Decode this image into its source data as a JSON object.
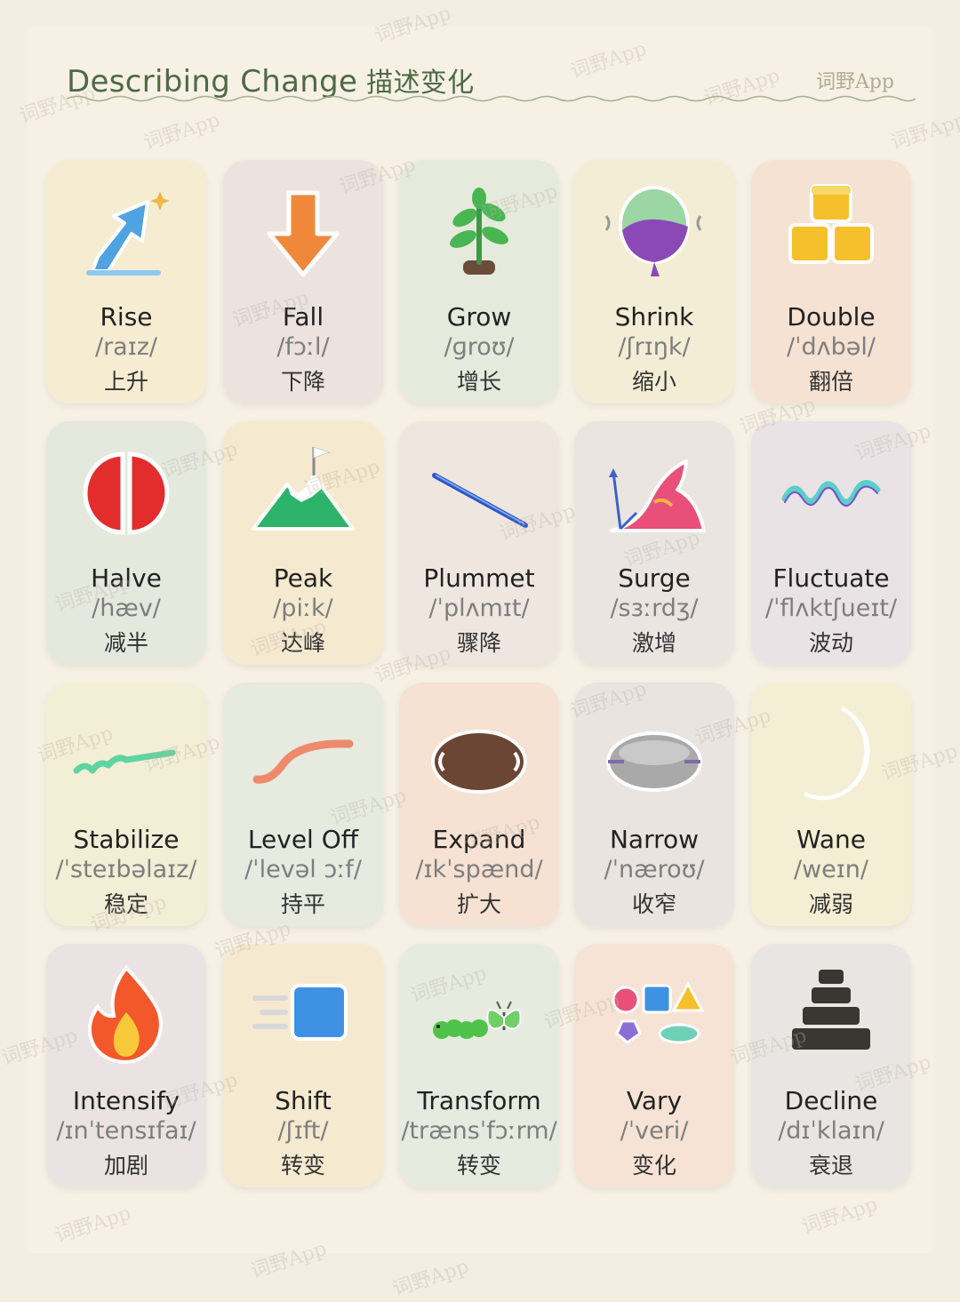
{
  "header": {
    "title": "Describing Change",
    "title_zh": "描述变化",
    "brand": "词野App"
  },
  "watermark": "词野App",
  "colors": {
    "title": "#4d6a45",
    "background": "#f3ede2",
    "card_yellow": "#f5ecd2",
    "card_pink": "#ede3e0",
    "card_green": "#e7ecdf",
    "card_peach": "#f5e3d5",
    "card_lilac": "#ebe3e6"
  },
  "cards": [
    {
      "word": "Rise",
      "ipa": "/raɪz/",
      "zh": "上升",
      "icon": "blue-arrow-up-icon",
      "bg": "#f5ecd2"
    },
    {
      "word": "Fall",
      "ipa": "/fɔːl/",
      "zh": "下降",
      "icon": "orange-arrow-down-icon",
      "bg": "#ece2de"
    },
    {
      "word": "Grow",
      "ipa": "/ɡroʊ/",
      "zh": "增长",
      "icon": "sprout-icon",
      "bg": "#e6eadc"
    },
    {
      "word": "Shrink",
      "ipa": "/ʃrɪŋk/",
      "zh": "缩小",
      "icon": "deflating-balloon-icon",
      "bg": "#f4edd5"
    },
    {
      "word": "Double",
      "ipa": "/ˈdʌbəl/",
      "zh": "翻倍",
      "icon": "stacked-cubes-icon",
      "bg": "#f6e2d3"
    },
    {
      "word": "Halve",
      "ipa": "/hæv/",
      "zh": "减半",
      "icon": "split-circle-icon",
      "bg": "#e5e8dd"
    },
    {
      "word": "Peak",
      "ipa": "/piːk/",
      "zh": "达峰",
      "icon": "mountain-flag-icon",
      "bg": "#f5ead0"
    },
    {
      "word": "Plummet",
      "ipa": "/ˈplʌmɪt/",
      "zh": "骤降",
      "icon": "falling-line-icon",
      "bg": "#efe7df"
    },
    {
      "word": "Surge",
      "ipa": "/sɜːrdʒ/",
      "zh": "激增",
      "icon": "wave-surge-icon",
      "bg": "#ebe5e2"
    },
    {
      "word": "Fluctuate",
      "ipa": "/ˈflʌktʃueɪt/",
      "zh": "波动",
      "icon": "zigzag-wave-icon",
      "bg": "#eae3e6"
    },
    {
      "word": "Stabilize",
      "ipa": "/ˈsteɪbəlaɪz/",
      "zh": "稳定",
      "icon": "stabilizing-line-icon",
      "bg": "#f3eed6"
    },
    {
      "word": "Level Off",
      "ipa": "/ˈlevəl ɔːf/",
      "zh": "持平",
      "icon": "leveling-curve-icon",
      "bg": "#e6eadf"
    },
    {
      "word": "Expand",
      "ipa": "/ɪkˈspænd/",
      "zh": "扩大",
      "icon": "expanding-disc-icon",
      "bg": "#f6e1d3"
    },
    {
      "word": "Narrow",
      "ipa": "/ˈnæroʊ/",
      "zh": "收窄",
      "icon": "narrowing-disc-icon",
      "bg": "#e9e4e0"
    },
    {
      "word": "Wane",
      "ipa": "/weɪn/",
      "zh": "减弱",
      "icon": "crescent-moon-icon",
      "bg": "#f4efd4"
    },
    {
      "word": "Intensify",
      "ipa": "/ɪnˈtensɪfaɪ/",
      "zh": "加剧",
      "icon": "flame-icon",
      "bg": "#ebe3e3"
    },
    {
      "word": "Shift",
      "ipa": "/ʃɪft/",
      "zh": "转变",
      "icon": "moving-square-icon",
      "bg": "#f5ead0"
    },
    {
      "word": "Transform",
      "ipa": "/trænsˈfɔːrm/",
      "zh": "转变",
      "icon": "caterpillar-butterfly-icon",
      "bg": "#e6ebdf"
    },
    {
      "word": "Vary",
      "ipa": "/ˈveri/",
      "zh": "变化",
      "icon": "mixed-shapes-icon",
      "bg": "#f6e3d5"
    },
    {
      "word": "Decline",
      "ipa": "/dɪˈklaɪn/",
      "zh": "衰退",
      "icon": "declining-steps-icon",
      "bg": "#e9e5e2"
    }
  ]
}
